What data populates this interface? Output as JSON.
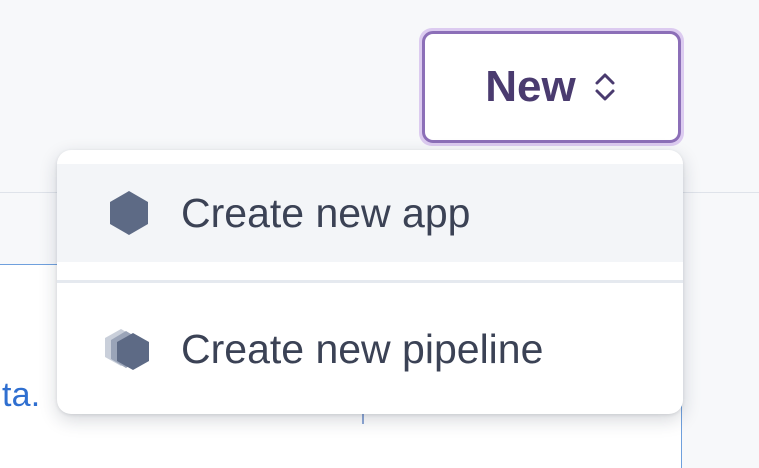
{
  "background": {
    "link_fragment": "ta."
  },
  "new_button": {
    "label": "New",
    "icon": "chevron-up-down-icon"
  },
  "menu": {
    "items": [
      {
        "label": "Create new app",
        "icon": "hexagon-icon",
        "highlighted": true
      },
      {
        "label": "Create new pipeline",
        "icon": "stacked-hexagons-icon",
        "highlighted": false
      }
    ]
  },
  "colors": {
    "accent_border": "#8c6fb8",
    "accent_glow": "#dccbf0",
    "button_text": "#4a3b6f",
    "menu_text": "#3b4255",
    "icon_fill": "#5d6a85",
    "link_blue": "#2f6fd0"
  }
}
